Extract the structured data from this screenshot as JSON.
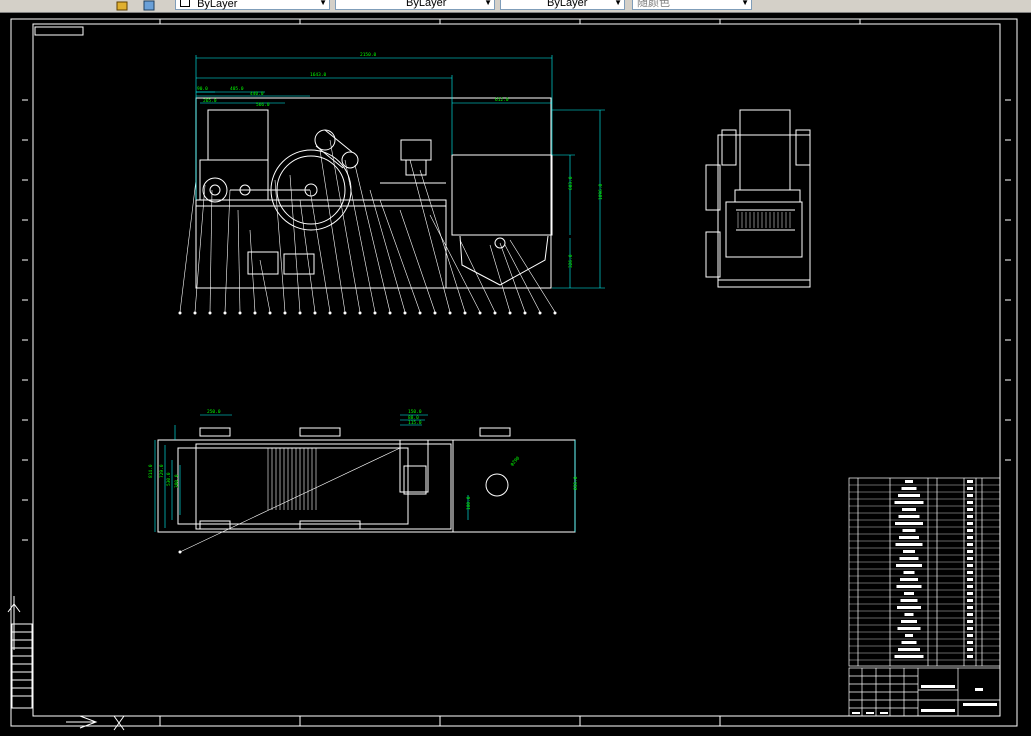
{
  "toolbar": {
    "linetype_1": "ByLayer",
    "linetype_2": "ByLayer",
    "lineweight": "ByLayer",
    "color_label": "随颜色"
  },
  "drawing": {
    "dims": {
      "overall_width": "2150.0",
      "frame_width": "1643.0",
      "right_unit_width": "612.0",
      "dim_a": "90.0",
      "dim_b": "405.0",
      "dim_c": "440.0",
      "dim_d": "265.0",
      "dim_e": "566.0",
      "overall_height": "1096.0",
      "height_upper": "603.0",
      "height_lower": "326.0",
      "top_width": "250.0",
      "top_small_a": "150.0",
      "top_small_b": "88.0",
      "top_small_c": "115.0",
      "top_left_a": "814.0",
      "top_left_b": "729.0",
      "top_left_c": "530.0",
      "top_left_d": "380.0",
      "top_right": "835.0",
      "top_mid": "180.0",
      "top_diag": "φ290"
    },
    "colors": {
      "background": "#000000",
      "geometry": "#ffffff",
      "dimension": "#00ff00",
      "dim_line": "#00ffff"
    }
  }
}
